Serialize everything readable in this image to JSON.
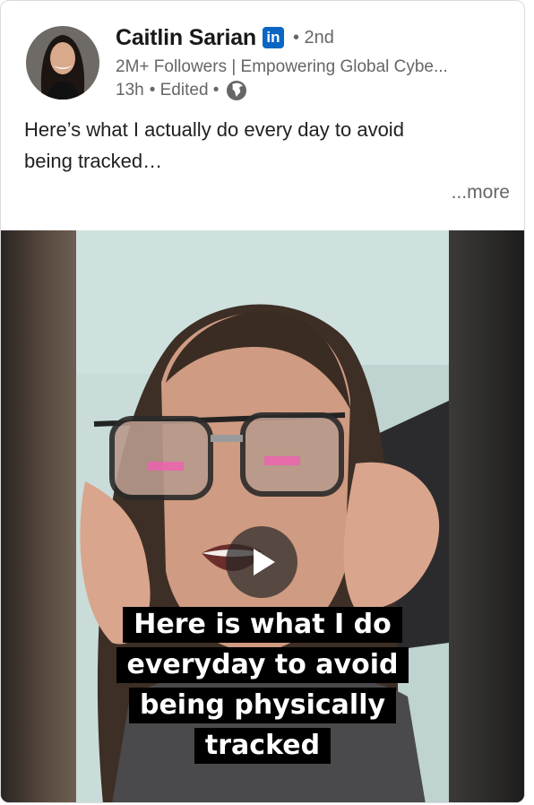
{
  "post": {
    "author": {
      "name": "Caitlin Sarian",
      "badge_text": "in",
      "degree": "• 2nd",
      "headline": "2M+ Followers | Empowering Global Cybe...",
      "time": "13h",
      "edited": "• Edited •",
      "visibility_icon": "globe-icon"
    },
    "text_line1": "Here’s what I actually do every day to avoid",
    "text_line2": "being tracked…",
    "more_label": "...more",
    "video": {
      "play_icon": "play-icon",
      "caption": [
        "Here is what I do",
        "everyday to avoid",
        "being physically",
        "tracked"
      ]
    }
  },
  "colors": {
    "linkedin_blue": "#0a66c2",
    "secondary_text": "#666666",
    "caption_bg": "#000000"
  }
}
